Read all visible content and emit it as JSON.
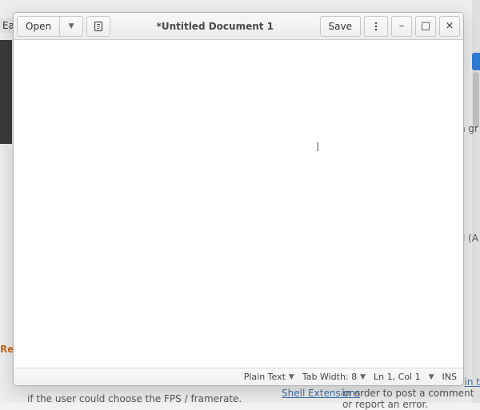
{
  "window": {
    "title": "*Untitled Document 1",
    "open_label": "Open",
    "save_label": "Save"
  },
  "status": {
    "language": "Plain Text",
    "tab_width_label": "Tab Width: 8",
    "cursor": "Ln 1, Col 1",
    "insert_mode": "INS"
  },
  "background": {
    "left_tag": "Eas",
    "right_frag_1": "n gr",
    "right_frag_2": "ll (A",
    "reviews_label": "Rev",
    "footer_line": "if the user could choose the FPS / framerate.",
    "shell_ext_link": "Shell Extensions",
    "footer_tail": " in order to post a comment or report an error.",
    "login_link": "in t"
  }
}
